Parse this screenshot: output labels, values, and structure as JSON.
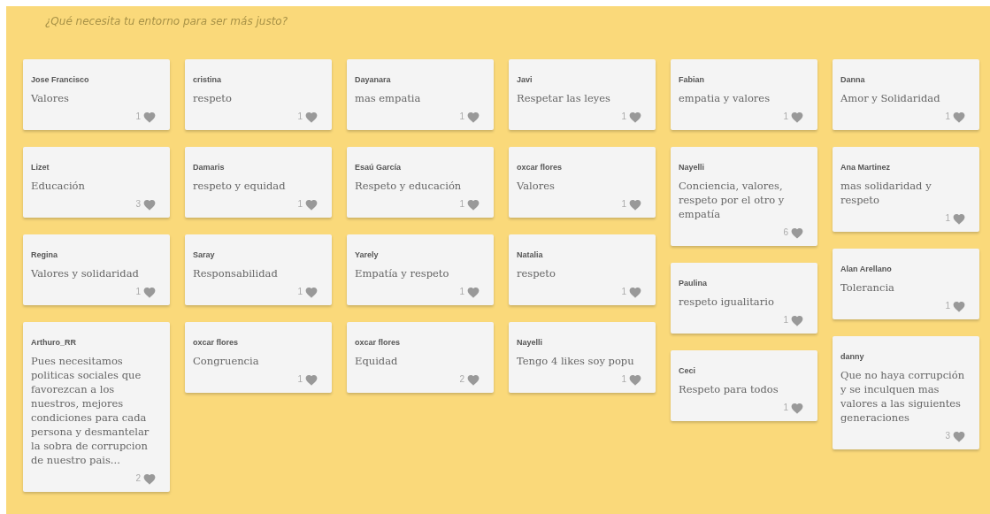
{
  "board": {
    "title": "¿Qué necesita tu entorno para ser más justo?"
  },
  "columns": [
    {
      "cards": [
        {
          "author": "Jose Francisco",
          "text": "Valores",
          "likes": "1"
        },
        {
          "author": "Lizet",
          "text": "Educación",
          "likes": "3"
        },
        {
          "author": "Regina",
          "text": "Valores y solidaridad",
          "likes": "1"
        },
        {
          "author": "Arthuro_RR",
          "text": "Pues necesitamos politicas sociales que favorezcan a los nuestros, mejores condiciones para cada persona y desmantelar la sobra de corrupcion de nuestro pais...",
          "likes": "2"
        }
      ]
    },
    {
      "cards": [
        {
          "author": "cristina",
          "text": "respeto",
          "likes": "1"
        },
        {
          "author": "Damaris",
          "text": "respeto y equidad",
          "likes": "1"
        },
        {
          "author": "Saray",
          "text": "Responsabilidad",
          "likes": "1"
        },
        {
          "author": "oxcar flores",
          "text": "Congruencia",
          "likes": "1"
        }
      ]
    },
    {
      "cards": [
        {
          "author": "Dayanara",
          "text": "mas empatia",
          "likes": "1"
        },
        {
          "author": "Esaú García",
          "text": "Respeto y educación",
          "likes": "1"
        },
        {
          "author": "Yarely",
          "text": "Empatía y respeto",
          "likes": "1"
        },
        {
          "author": "oxcar flores",
          "text": "Equidad",
          "likes": "2"
        }
      ]
    },
    {
      "cards": [
        {
          "author": "Javi",
          "text": "Respetar las leyes",
          "likes": "1"
        },
        {
          "author": "oxcar flores",
          "text": "Valores",
          "likes": "1"
        },
        {
          "author": "Natalia",
          "text": "respeto",
          "likes": "1"
        },
        {
          "author": "Nayelli",
          "text": "Tengo 4 likes soy popu",
          "likes": "1"
        }
      ]
    },
    {
      "cards": [
        {
          "author": "Fabian",
          "text": "empatia y valores",
          "likes": "1"
        },
        {
          "author": "Nayelli",
          "text": "Conciencia, valores, respeto por el otro y empatía",
          "likes": "6"
        },
        {
          "author": "Paulina",
          "text": "respeto igualitario",
          "likes": "1"
        },
        {
          "author": "Ceci",
          "text": "Respeto para todos",
          "likes": "1"
        }
      ]
    },
    {
      "cards": [
        {
          "author": "Danna",
          "text": "Amor y Solidaridad",
          "likes": "1"
        },
        {
          "author": "Ana Martinez",
          "text": "mas solidaridad y respeto",
          "likes": "1"
        },
        {
          "author": "Alan Arellano",
          "text": "Tolerancia",
          "likes": "1"
        },
        {
          "author": "danny",
          "text": "Que no haya corrupción y se inculquen mas valores a las siguientes generaciones",
          "likes": "3"
        }
      ]
    }
  ]
}
